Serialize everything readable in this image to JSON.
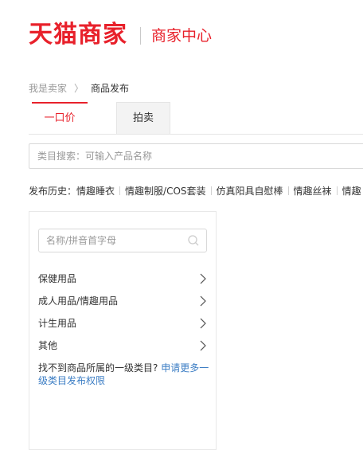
{
  "header": {
    "logo_main": "天猫商家",
    "logo_sub": "商家中心"
  },
  "breadcrumb": {
    "root": "我是卖家",
    "separator": "〉",
    "current": "商品发布"
  },
  "tabs": [
    {
      "label": "一口价",
      "active": true
    },
    {
      "label": "拍卖",
      "active": false
    }
  ],
  "category_search": {
    "placeholder": "类目搜索：可输入产品名称"
  },
  "history": {
    "label": "发布历史：",
    "items": [
      "情趣睡衣",
      "情趣制服/COS套装",
      "仿真阳具自慰棒",
      "情趣丝袜",
      "情趣"
    ]
  },
  "category_panel": {
    "search_placeholder": "名称/拼音首字母",
    "items": [
      "保健用品",
      "成人用品/情趣用品",
      "计生用品",
      "其他"
    ],
    "note_text": "找不到商品所属的一级类目?",
    "note_link": "申请更多一级类目发布权限"
  },
  "colors": {
    "brand": "#e8212b",
    "link": "#3b7dc4"
  },
  "icons": {
    "search": "search-icon",
    "chevron": "chevron-right-icon"
  }
}
